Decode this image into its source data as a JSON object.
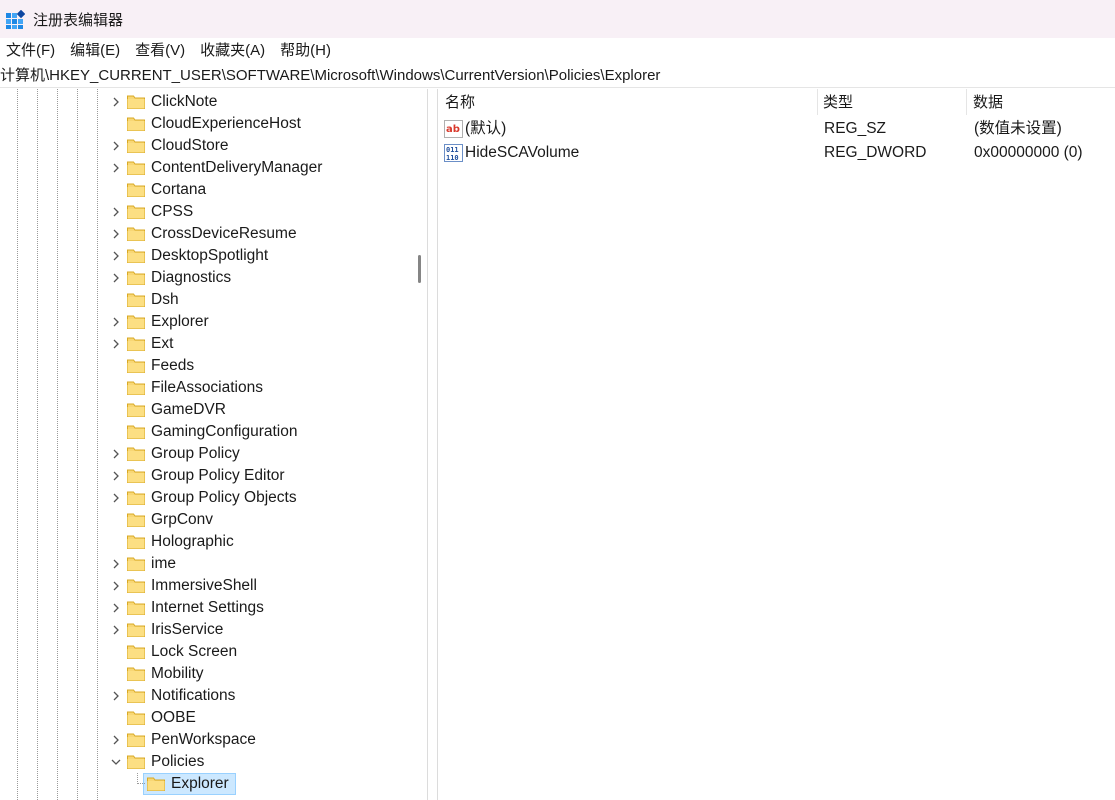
{
  "window": {
    "title": "注册表编辑器"
  },
  "menu": [
    "文件(F)",
    "编辑(E)",
    "查看(V)",
    "收藏夹(A)",
    "帮助(H)"
  ],
  "address": "计算机\\HKEY_CURRENT_USER\\SOFTWARE\\Microsoft\\Windows\\CurrentVersion\\Policies\\Explorer",
  "tree": {
    "nodes": [
      {
        "label": "ClickNote",
        "expander": "collapsed"
      },
      {
        "label": "CloudExperienceHost",
        "expander": "none"
      },
      {
        "label": "CloudStore",
        "expander": "collapsed"
      },
      {
        "label": "ContentDeliveryManager",
        "expander": "collapsed"
      },
      {
        "label": "Cortana",
        "expander": "none"
      },
      {
        "label": "CPSS",
        "expander": "collapsed"
      },
      {
        "label": "CrossDeviceResume",
        "expander": "collapsed"
      },
      {
        "label": "DesktopSpotlight",
        "expander": "collapsed"
      },
      {
        "label": "Diagnostics",
        "expander": "collapsed"
      },
      {
        "label": "Dsh",
        "expander": "none"
      },
      {
        "label": "Explorer",
        "expander": "collapsed"
      },
      {
        "label": "Ext",
        "expander": "collapsed"
      },
      {
        "label": "Feeds",
        "expander": "none"
      },
      {
        "label": "FileAssociations",
        "expander": "none"
      },
      {
        "label": "GameDVR",
        "expander": "none"
      },
      {
        "label": "GamingConfiguration",
        "expander": "none"
      },
      {
        "label": "Group Policy",
        "expander": "collapsed"
      },
      {
        "label": "Group Policy Editor",
        "expander": "collapsed"
      },
      {
        "label": "Group Policy Objects",
        "expander": "collapsed"
      },
      {
        "label": "GrpConv",
        "expander": "none"
      },
      {
        "label": "Holographic",
        "expander": "none"
      },
      {
        "label": "ime",
        "expander": "collapsed"
      },
      {
        "label": "ImmersiveShell",
        "expander": "collapsed"
      },
      {
        "label": "Internet Settings",
        "expander": "collapsed"
      },
      {
        "label": "IrisService",
        "expander": "collapsed"
      },
      {
        "label": "Lock Screen",
        "expander": "none"
      },
      {
        "label": "Mobility",
        "expander": "none"
      },
      {
        "label": "Notifications",
        "expander": "collapsed"
      },
      {
        "label": "OOBE",
        "expander": "none"
      },
      {
        "label": "PenWorkspace",
        "expander": "collapsed"
      },
      {
        "label": "Policies",
        "expander": "expanded"
      },
      {
        "label": "Explorer",
        "expander": "none",
        "child": true,
        "selected": true
      }
    ]
  },
  "list": {
    "columns": [
      "名称",
      "类型",
      "数据"
    ],
    "rows": [
      {
        "icon": "string-value-icon",
        "name": "(默认)",
        "type": "REG_SZ",
        "data": "(数值未设置)"
      },
      {
        "icon": "binary-value-icon",
        "name": "HideSCAVolume",
        "type": "REG_DWORD",
        "data": "0x00000000 (0)"
      }
    ]
  },
  "colors": {
    "titlebar": "#f8f0f6",
    "selection": "#cce8ff",
    "folder": "#f8d775",
    "accent": "#1a73e8"
  }
}
